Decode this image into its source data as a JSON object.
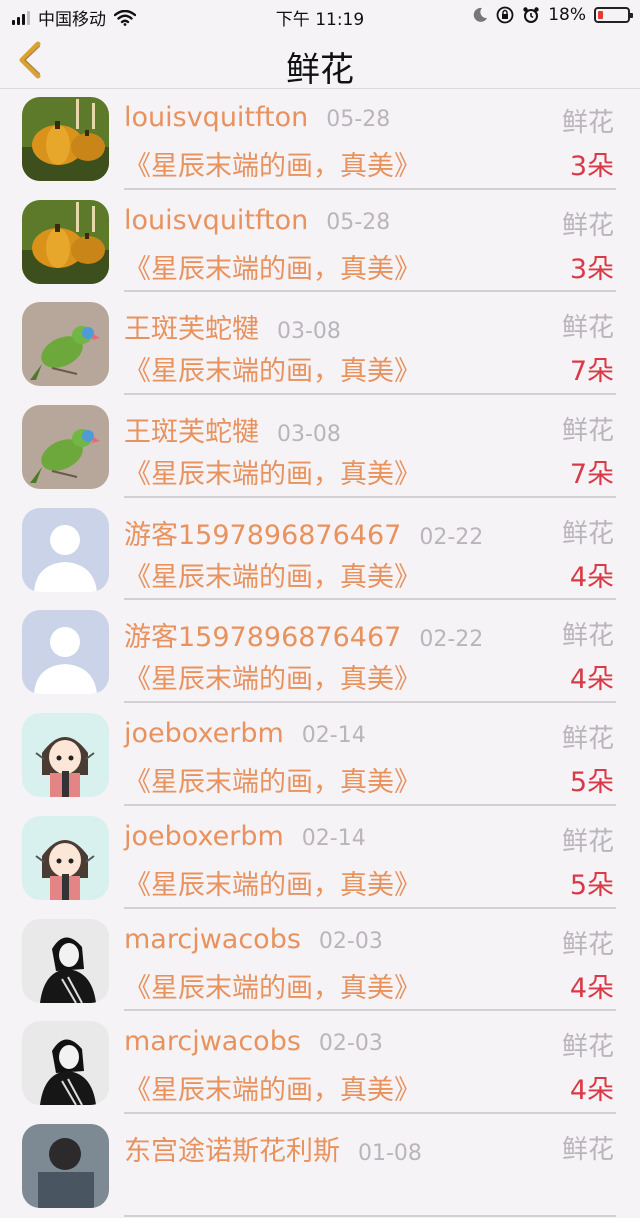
{
  "status_bar": {
    "carrier": "中国移动",
    "time": "下午 11:19",
    "battery": "18%",
    "battery_level": 0.18
  },
  "nav": {
    "title": "鲜花",
    "back_icon": "chevron-left-icon"
  },
  "colors": {
    "accent": "#e8925e",
    "count": "#d93a47",
    "muted": "#b9b5ba",
    "background": "#f6f3f7"
  },
  "rows": [
    {
      "name": "louisvquitfton",
      "date": "05-28",
      "type": "鲜花",
      "message": "《星辰末端的画，真美》",
      "count": "3朵",
      "avatar": "pumpkin-avatar"
    },
    {
      "name": "louisvquitfton",
      "date": "05-28",
      "type": "鲜花",
      "message": "《星辰末端的画，真美》",
      "count": "3朵",
      "avatar": "pumpkin-avatar"
    },
    {
      "name": "王斑芙蛇犍",
      "date": "03-08",
      "type": "鲜花",
      "message": "《星辰末端的画，真美》",
      "count": "7朵",
      "avatar": "parrot-avatar"
    },
    {
      "name": "王斑芙蛇犍",
      "date": "03-08",
      "type": "鲜花",
      "message": "《星辰末端的画，真美》",
      "count": "7朵",
      "avatar": "parrot-avatar"
    },
    {
      "name": "游客1597896876467",
      "date": "02-22",
      "type": "鲜花",
      "message": "《星辰末端的画，真美》",
      "count": "4朵",
      "avatar": "default-user-avatar"
    },
    {
      "name": "游客1597896876467",
      "date": "02-22",
      "type": "鲜花",
      "message": "《星辰末端的画，真美》",
      "count": "4朵",
      "avatar": "default-user-avatar"
    },
    {
      "name": "joeboxerbm",
      "date": "02-14",
      "type": "鲜花",
      "message": "《星辰末端的画，真美》",
      "count": "5朵",
      "avatar": "anime-girl-avatar"
    },
    {
      "name": "joeboxerbm",
      "date": "02-14",
      "type": "鲜花",
      "message": "《星辰末端的画，真美》",
      "count": "5朵",
      "avatar": "anime-girl-avatar"
    },
    {
      "name": "marcjwacobs",
      "date": "02-03",
      "type": "鲜花",
      "message": "《星辰末端的画，真美》",
      "count": "4朵",
      "avatar": "sketch-avatar"
    },
    {
      "name": "marcjwacobs",
      "date": "02-03",
      "type": "鲜花",
      "message": "《星辰末端的画，真美》",
      "count": "4朵",
      "avatar": "sketch-avatar"
    },
    {
      "name": "东宫途诺斯花利斯",
      "date": "01-08",
      "type": "鲜花",
      "message": "",
      "count": "",
      "avatar": "photo-avatar"
    }
  ]
}
